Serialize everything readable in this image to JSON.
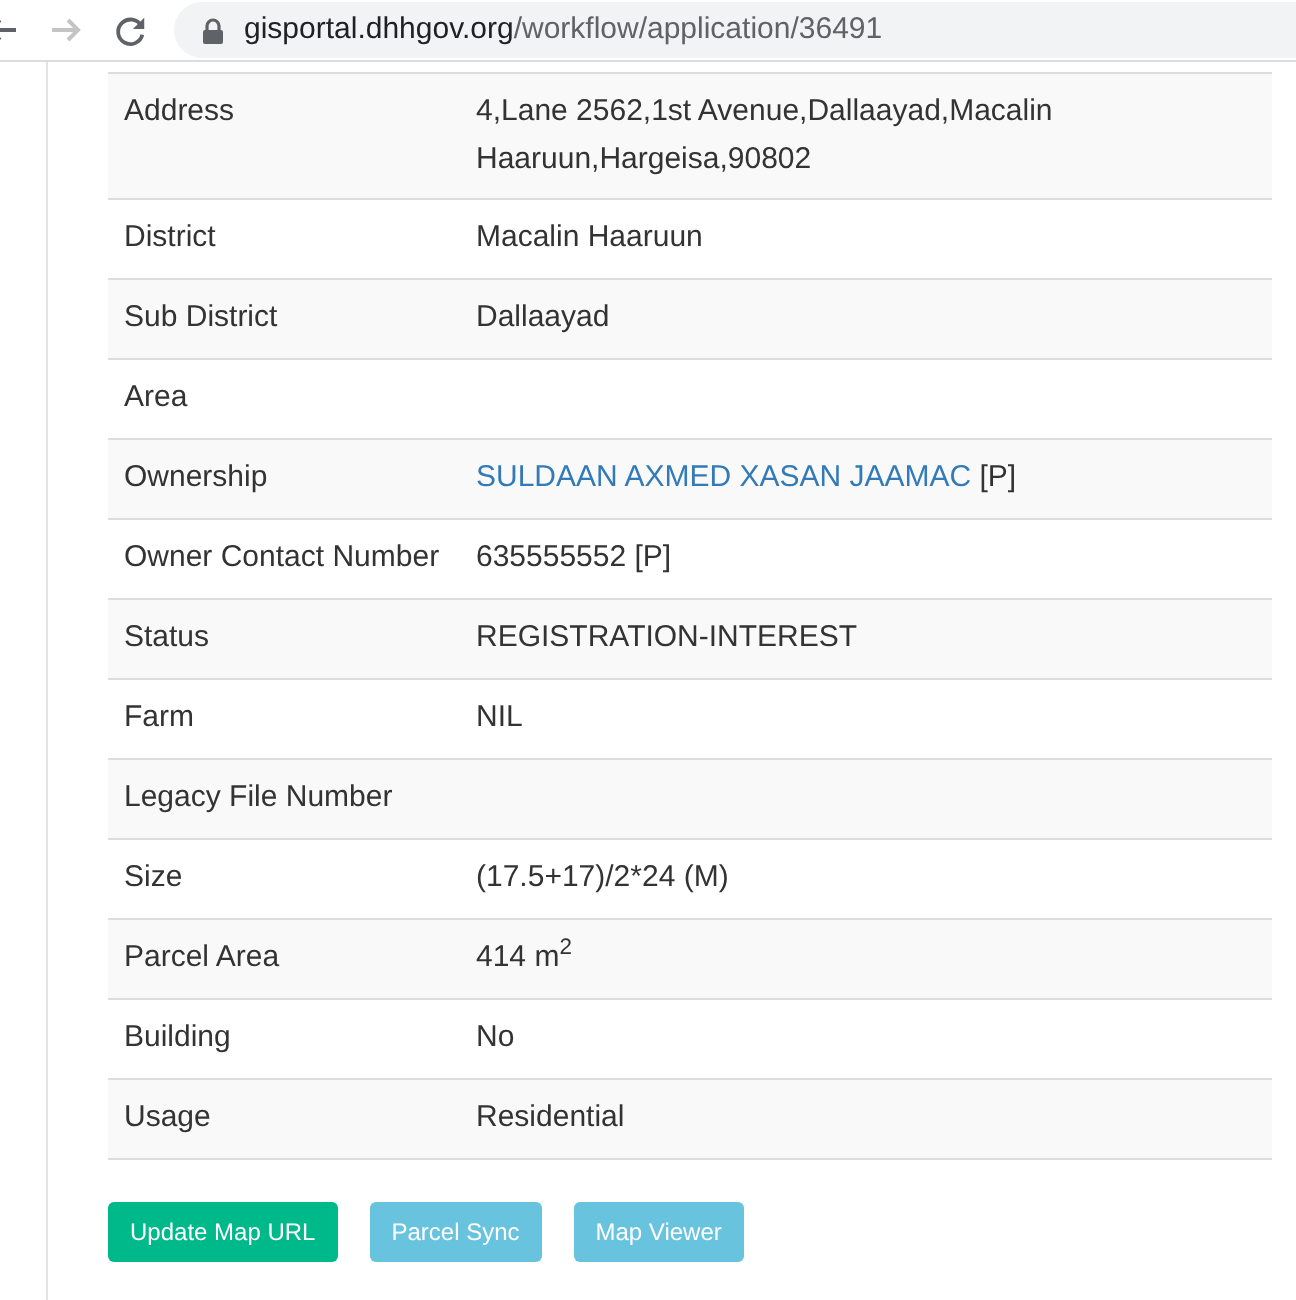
{
  "browser": {
    "back_disabled": false,
    "forward_disabled": true,
    "url_host": "gisportal.dhhgov.org",
    "url_path": "/workflow/application/36491"
  },
  "details": [
    {
      "label": "Address",
      "value": "4,Lane 2562,1st Avenue,Dallaayad,Macalin Haaruun,Hargeisa,90802"
    },
    {
      "label": "District",
      "value": "Macalin Haaruun"
    },
    {
      "label": "Sub District",
      "value": "Dallaayad"
    },
    {
      "label": "Area"
    },
    {
      "label": "Ownership",
      "link": "SULDAAN AXMED XASAN JAAMAC",
      "value": "[P]"
    },
    {
      "label": "Owner Contact Number",
      "value": "635555552 [P]"
    },
    {
      "label": "Status",
      "value": "REGISTRATION-INTEREST"
    },
    {
      "label": "Farm",
      "value": "NIL"
    },
    {
      "label": "Legacy File Number"
    },
    {
      "label": "Size",
      "value": "(17.5+17)/2*24 (M)"
    },
    {
      "label": "Parcel Area",
      "value": "414 m$^{2}$"
    },
    {
      "label": "Building",
      "value": "No"
    },
    {
      "label": "Usage",
      "value": "Residential"
    }
  ],
  "buttons": [
    {
      "label": "Update Map URL",
      "kind": "success"
    },
    {
      "label": "Parcel Sync",
      "kind": "info"
    },
    {
      "label": "Map Viewer",
      "kind": "info"
    }
  ]
}
